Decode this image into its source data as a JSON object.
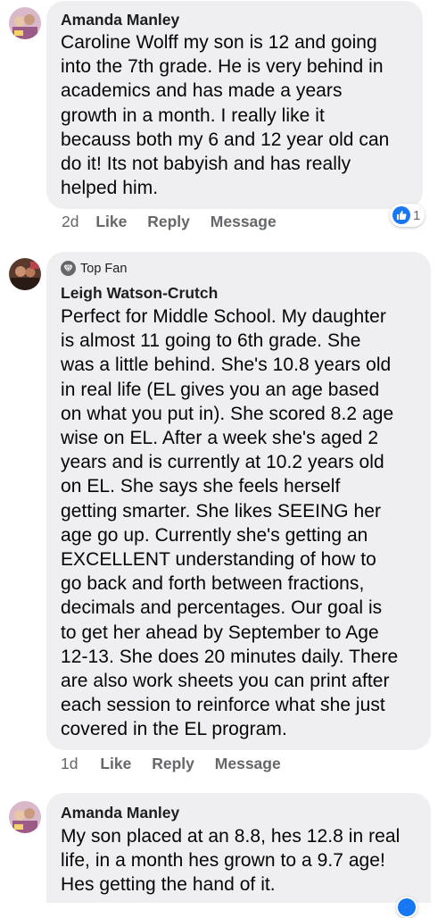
{
  "comments": [
    {
      "author": "Amanda Manley",
      "lines": [
        "Caroline Wolff my son is 12 and going",
        "into the 7th grade. He is very behind in",
        "academics and has made a years",
        "growth in a month. I really like it",
        "becauss both my 6 and 12 year old can",
        "do it! Its not babyish and has really",
        "helped him."
      ],
      "time": "2d",
      "like_label": "Like",
      "reply_label": "Reply",
      "message_label": "Message",
      "reaction_count": "1"
    },
    {
      "badge": "Top Fan",
      "author": "Leigh Watson-Crutch",
      "lines": [
        "Perfect for Middle School. My daughter",
        "is almost 11 going to 6th grade. She",
        "was a little behind. She's 10.8 years old",
        "in real life (EL gives you an age based",
        "on what you put in). She scored 8.2 age",
        "wise on EL. After a week she's aged 2",
        "years and is currently at 10.2 years old",
        "on EL. She says she feels herself",
        "getting smarter. She likes SEEING her",
        "age go up. Currently she's getting an",
        "EXCELLENT understanding of how to",
        "go back and forth between fractions,",
        "decimals and percentages. Our goal is",
        "to get her ahead by September to Age",
        "12-13. She does 20 minutes daily. There",
        "are also work sheets you can print after",
        "each session to reinforce what she just",
        "covered in the EL program."
      ],
      "time": "1d",
      "like_label": "Like",
      "reply_label": "Reply",
      "message_label": "Message"
    },
    {
      "author": "Amanda Manley",
      "lines": [
        "My son placed at an 8.8, hes 12.8 in real",
        "life, in a month hes grown to a 9.7 age!",
        "Hes getting the hand of it."
      ]
    }
  ],
  "colors": {
    "bubble": "#efeff2",
    "meta": "#65676b",
    "like_blue": "#1877f2"
  }
}
